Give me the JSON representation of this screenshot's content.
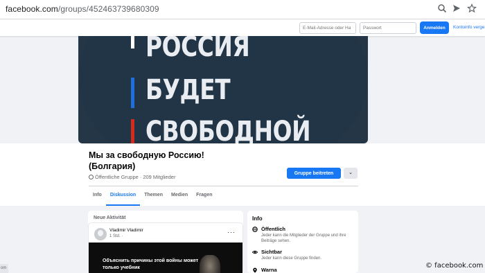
{
  "browser": {
    "url_domain": "facebook.com",
    "url_path": "/groups/452463739680309",
    "icons": [
      "zoom-icon",
      "share-arrow-icon",
      "star-icon"
    ]
  },
  "fb_bar": {
    "email_placeholder": "E-Mail-Adresse oder Ha",
    "password_placeholder": "Passwort",
    "login_label": "Anmelden",
    "forgot_label": "Kontoinfo verge"
  },
  "cover": {
    "lines": [
      "РОССИЯ",
      "БУДЕТ",
      "СВОБОДНОЙ"
    ],
    "colors": {
      "background": "#253747",
      "stripe_white": "#ffffff",
      "stripe_blue": "#1e6fd9",
      "stripe_red": "#d52b1e"
    }
  },
  "group": {
    "title": "Мы за свободную Россию! (Болгария)",
    "privacy": "Öffentliche Gruppe",
    "separator": "·",
    "members": "209 Mitglieder",
    "join_label": "Gruppe beitreten",
    "more_label": "⌄"
  },
  "tabs": [
    {
      "label": "Info",
      "active": false
    },
    {
      "label": "Diskussion",
      "active": true
    },
    {
      "label": "Themen",
      "active": false
    },
    {
      "label": "Medien",
      "active": false
    },
    {
      "label": "Fragen",
      "active": false
    }
  ],
  "feed": {
    "section_title": "Neue Aktivität",
    "post": {
      "author": "Vladimir Vladimir",
      "time": "1 Std. ·",
      "menu": "···",
      "image_text": "Объяснить причины этой войны может только учебник"
    }
  },
  "info_panel": {
    "title": "Info",
    "items": [
      {
        "icon": "globe-icon",
        "title": "Öffentlich",
        "desc": "Jeder kann die Mitglieder der Gruppe und ihre Beiträge sehen."
      },
      {
        "icon": "eye-icon",
        "title": "Sichtbar",
        "desc": "Jeder kann diese Gruppe finden."
      },
      {
        "icon": "location-pin-icon",
        "title": "Warna",
        "desc": ""
      }
    ]
  },
  "watermark": "© facebook.com",
  "left_crop_text": "om",
  "colors": {
    "accent": "#1877f2",
    "page_bg": "#f0f2f5",
    "text_secondary": "#65676b"
  }
}
